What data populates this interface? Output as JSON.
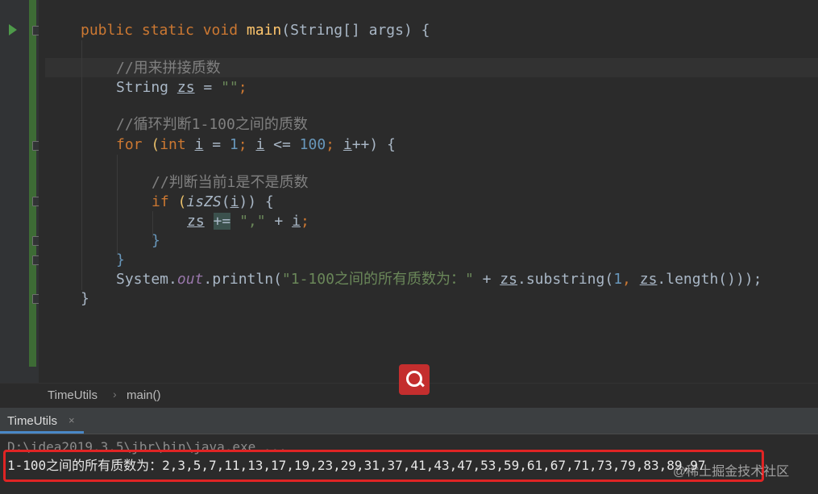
{
  "editor": {
    "lines": {
      "l1": {
        "kw": "public static void ",
        "fn": "main",
        "rest": "(String[] args) {"
      },
      "l2": {
        "comment": "//用来拼接质数"
      },
      "l3": {
        "type": "String ",
        "var": "zs",
        "op": " = ",
        "str": "\"\"",
        "end": ";"
      },
      "l4": {
        "comment": "//循环判断1-100之间的质数"
      },
      "l5": {
        "kw1": "for ",
        "p1": "(",
        "kw2": "int ",
        "v1": "i",
        "a": " = ",
        "n1": "1",
        "b": "; ",
        "v2": "i",
        "c": " <= ",
        "n2": "100",
        "d": "; ",
        "v3": "i",
        "e": "++) {"
      },
      "l6": {
        "comment": "//判断当前i是不是质数"
      },
      "l7": {
        "kw": "if ",
        "p1": "(",
        "fn": "isZS",
        "p2": "(",
        "v": "i",
        "p3": ")) {"
      },
      "l8": {
        "v": "zs",
        "sp": " ",
        "op": "+=",
        "sp2": " ",
        "str": "\",\"",
        "plus": " + ",
        "v2": "i",
        "end": ";"
      },
      "l9": {
        "text": "}"
      },
      "l10": {
        "text": "}"
      },
      "l11": {
        "cls": "System.",
        "field": "out",
        "m": ".println(",
        "str": "\"1-100之间的所有质数为：\"",
        "plus": " + ",
        "v1": "zs",
        "m2": ".substring(",
        "n": "1",
        "comma": ", ",
        "v2": "zs",
        "m3": ".length()));"
      },
      "l12": {
        "text": "}"
      }
    }
  },
  "breadcrumb": {
    "file": "TimeUtils",
    "sep": "›",
    "method": "main()"
  },
  "run": {
    "tab_label": "TimeUtils",
    "tab_close": "×",
    "command": "D:\\idea2019.3.5\\jbr\\bin\\java.exe ...",
    "output": "1-100之间的所有质数为：2,3,5,7,11,13,17,19,23,29,31,37,41,43,47,53,59,61,67,71,73,79,83,89,97"
  },
  "watermark": "@稀土掘金技术社区",
  "colors": {
    "accent": "#4a88c7",
    "highlight_box": "#e02424",
    "search_button": "#c42e2e"
  }
}
